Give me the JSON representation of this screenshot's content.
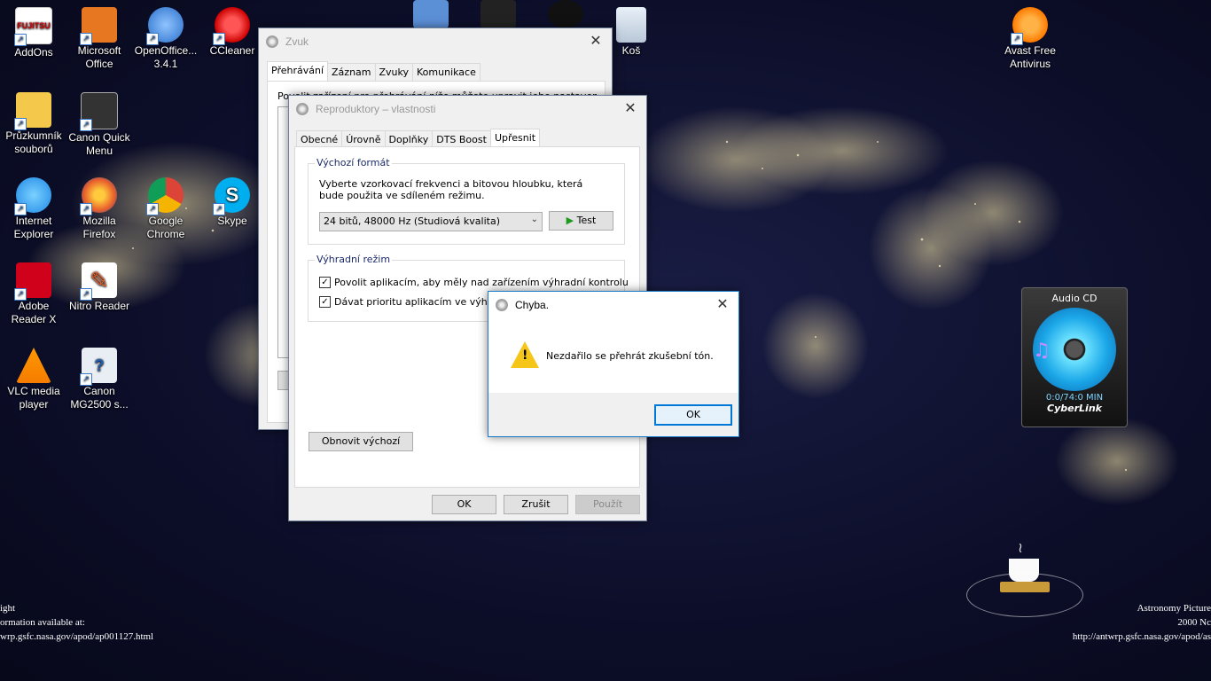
{
  "desktop": {
    "icons": [
      {
        "label": "AddOns",
        "x": 0,
        "y": 0
      },
      {
        "label": "Microsoft Office"
      },
      {
        "label": "OpenOffice... 3.4.1"
      },
      {
        "label": "CCleaner"
      },
      {
        "label": "Koš"
      },
      {
        "label": "Avast Free Antivirus"
      },
      {
        "label": "Průzkumník souborů"
      },
      {
        "label": "Canon Quick Menu"
      },
      {
        "label": "Internet Explorer"
      },
      {
        "label": "Mozilla Firefox"
      },
      {
        "label": "Google Chrome"
      },
      {
        "label": "Skype"
      },
      {
        "label": "Adobe Reader X"
      },
      {
        "label": "Nitro Reader"
      },
      {
        "label": "VLC media player"
      },
      {
        "label": "Canon MG2500 s..."
      }
    ],
    "apod_left": [
      "ight",
      "ormation available at:",
      "wrp.gsfc.nasa.gov/apod/ap001127.html"
    ],
    "apod_right": [
      "Astronomy Picture",
      "2000 Nc",
      "http://antwrp.gsfc.nasa.gov/apod/as"
    ]
  },
  "gadget": {
    "title": "Audio CD",
    "time": "0:0/74:0 MIN",
    "brand": "CyberLink"
  },
  "zvuk": {
    "title": "Zvuk",
    "tabs": [
      "Přehrávání",
      "Záznam",
      "Zvuky",
      "Komunikace"
    ],
    "partial_text": "Povolit zařízení pro přehrávání níže můžete upravit jeho nastavení",
    "partial_btn": "K"
  },
  "props": {
    "title": "Reproduktory – vlastnosti",
    "tabs": [
      "Obecné",
      "Úrovně",
      "Doplňky",
      "DTS Boost",
      "Upřesnit"
    ],
    "default_format": {
      "legend": "Výchozí formát",
      "description": "Vyberte vzorkovací frekvenci a bitovou hloubku, která bude použita ve sdíleném režimu.",
      "selected": "24 bitů, 48000 Hz (Studiová kvalita)",
      "test_label": "Test"
    },
    "exclusive": {
      "legend": "Výhradní režim",
      "option1": "Povolit aplikacím, aby měly nad zařízením výhradní kontrolu",
      "option2": "Dávat prioritu aplikacím ve výhradním režimu"
    },
    "restore_label": "Obnovit výchozí",
    "ok_label": "OK",
    "cancel_label": "Zrušit",
    "apply_label": "Použít"
  },
  "error": {
    "title": "Chyba.",
    "message": "Nezdařilo se přehrát zkušební tón.",
    "ok_label": "OK"
  }
}
